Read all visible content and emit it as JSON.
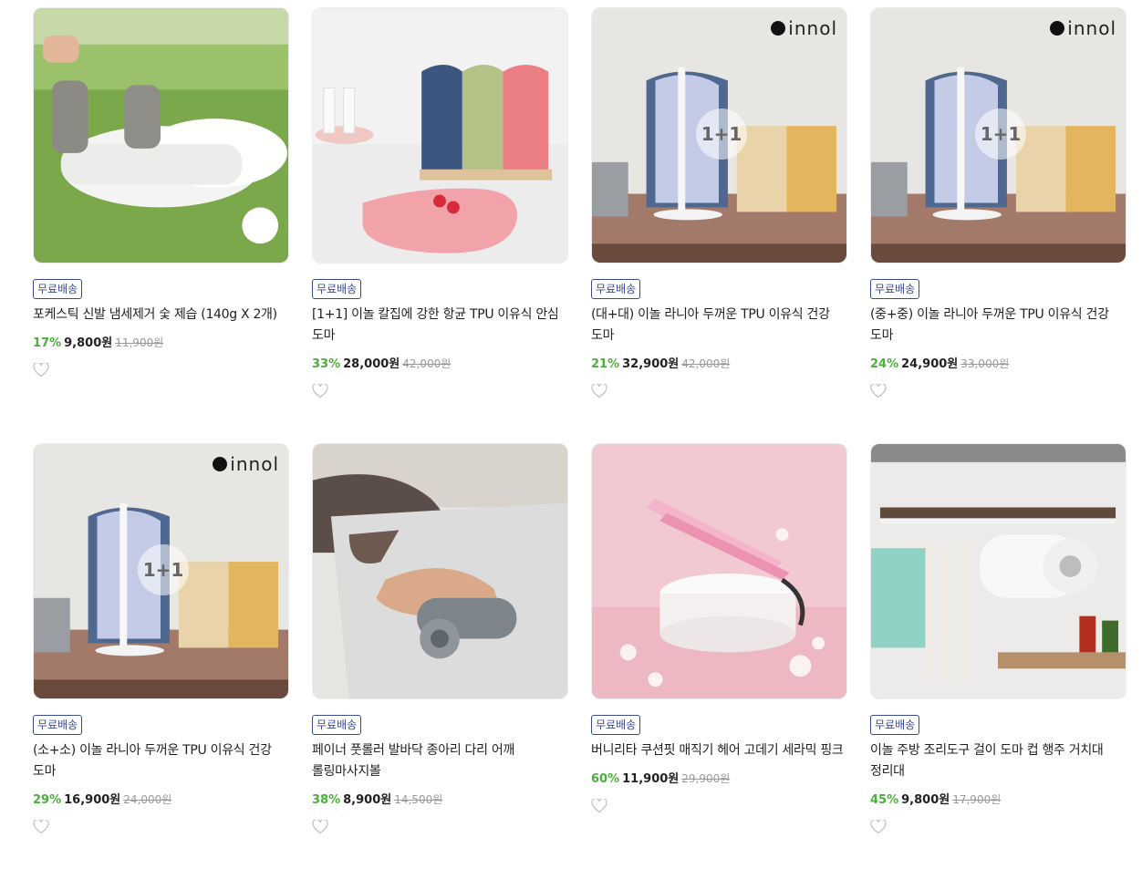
{
  "products": [
    {
      "badge": "무료배송",
      "name": "포케스틱 신발 냄세제거 숯 제습 (140g X 2개)",
      "discount": "17%",
      "price": "9,800원",
      "original": "11,900원",
      "image": "golf-shoes-deodorizer"
    },
    {
      "badge": "무료배송",
      "name": "[1+1] 이놀 칼집에 강한 항균 TPU 이유식 안심 도마",
      "discount": "33%",
      "price": "28,000원",
      "original": "42,000원",
      "image": "cutting-boards-stand"
    },
    {
      "badge": "무료배송",
      "name": "(대+대) 이놀 라니아 두꺼운 TPU 이유식 건강 도마",
      "discount": "21%",
      "price": "32,900원",
      "original": "42,000원",
      "image": "innol-cutting-board",
      "logo": "innol",
      "overlay": "1+1"
    },
    {
      "badge": "무료배송",
      "name": "(중+중) 이놀 라니아 두꺼운 TPU 이유식 건강 도마",
      "discount": "24%",
      "price": "24,900원",
      "original": "33,000원",
      "image": "innol-cutting-board",
      "logo": "innol",
      "overlay": "1+1"
    },
    {
      "badge": "무료배송",
      "name": "(소+소) 이놀 라니아 두꺼운 TPU 이유식 건강 도마",
      "discount": "29%",
      "price": "16,900원",
      "original": "24,000원",
      "image": "innol-cutting-board",
      "logo": "innol",
      "overlay": "1+1"
    },
    {
      "badge": "무료배송",
      "name": "페이너 풋롤러 발바닥 종아리 다리 어깨 롤링마사지볼",
      "discount": "38%",
      "price": "8,900원",
      "original": "14,500원",
      "image": "foot-roller"
    },
    {
      "badge": "무료배송",
      "name": "버니리타 쿠션핏 매직기 헤어 고데기 세라믹 핑크",
      "discount": "60%",
      "price": "11,900원",
      "original": "29,900원",
      "image": "pink-hair-straightener"
    },
    {
      "badge": "무료배송",
      "name": "이놀 주방 조리도구 걸이 도마 컵 행주 거치대 정리대",
      "discount": "45%",
      "price": "9,800원",
      "original": "17,900원",
      "image": "kitchen-rack"
    }
  ],
  "icons": {
    "wishlist": "heart-outline-icon"
  },
  "colors": {
    "discount": "#4caf3c",
    "badge": "#3b4a8c"
  }
}
